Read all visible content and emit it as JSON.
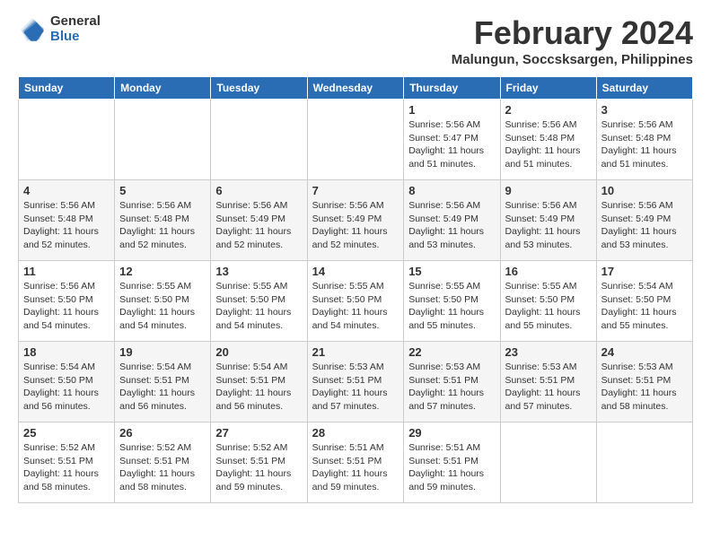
{
  "header": {
    "logo_general": "General",
    "logo_blue": "Blue",
    "month_title": "February 2024",
    "location": "Malungun, Soccsksargen, Philippines"
  },
  "days_of_week": [
    "Sunday",
    "Monday",
    "Tuesday",
    "Wednesday",
    "Thursday",
    "Friday",
    "Saturday"
  ],
  "weeks": [
    [
      {
        "num": "",
        "info": ""
      },
      {
        "num": "",
        "info": ""
      },
      {
        "num": "",
        "info": ""
      },
      {
        "num": "",
        "info": ""
      },
      {
        "num": "1",
        "info": "Sunrise: 5:56 AM\nSunset: 5:47 PM\nDaylight: 11 hours\nand 51 minutes."
      },
      {
        "num": "2",
        "info": "Sunrise: 5:56 AM\nSunset: 5:48 PM\nDaylight: 11 hours\nand 51 minutes."
      },
      {
        "num": "3",
        "info": "Sunrise: 5:56 AM\nSunset: 5:48 PM\nDaylight: 11 hours\nand 51 minutes."
      }
    ],
    [
      {
        "num": "4",
        "info": "Sunrise: 5:56 AM\nSunset: 5:48 PM\nDaylight: 11 hours\nand 52 minutes."
      },
      {
        "num": "5",
        "info": "Sunrise: 5:56 AM\nSunset: 5:48 PM\nDaylight: 11 hours\nand 52 minutes."
      },
      {
        "num": "6",
        "info": "Sunrise: 5:56 AM\nSunset: 5:49 PM\nDaylight: 11 hours\nand 52 minutes."
      },
      {
        "num": "7",
        "info": "Sunrise: 5:56 AM\nSunset: 5:49 PM\nDaylight: 11 hours\nand 52 minutes."
      },
      {
        "num": "8",
        "info": "Sunrise: 5:56 AM\nSunset: 5:49 PM\nDaylight: 11 hours\nand 53 minutes."
      },
      {
        "num": "9",
        "info": "Sunrise: 5:56 AM\nSunset: 5:49 PM\nDaylight: 11 hours\nand 53 minutes."
      },
      {
        "num": "10",
        "info": "Sunrise: 5:56 AM\nSunset: 5:49 PM\nDaylight: 11 hours\nand 53 minutes."
      }
    ],
    [
      {
        "num": "11",
        "info": "Sunrise: 5:56 AM\nSunset: 5:50 PM\nDaylight: 11 hours\nand 54 minutes."
      },
      {
        "num": "12",
        "info": "Sunrise: 5:55 AM\nSunset: 5:50 PM\nDaylight: 11 hours\nand 54 minutes."
      },
      {
        "num": "13",
        "info": "Sunrise: 5:55 AM\nSunset: 5:50 PM\nDaylight: 11 hours\nand 54 minutes."
      },
      {
        "num": "14",
        "info": "Sunrise: 5:55 AM\nSunset: 5:50 PM\nDaylight: 11 hours\nand 54 minutes."
      },
      {
        "num": "15",
        "info": "Sunrise: 5:55 AM\nSunset: 5:50 PM\nDaylight: 11 hours\nand 55 minutes."
      },
      {
        "num": "16",
        "info": "Sunrise: 5:55 AM\nSunset: 5:50 PM\nDaylight: 11 hours\nand 55 minutes."
      },
      {
        "num": "17",
        "info": "Sunrise: 5:54 AM\nSunset: 5:50 PM\nDaylight: 11 hours\nand 55 minutes."
      }
    ],
    [
      {
        "num": "18",
        "info": "Sunrise: 5:54 AM\nSunset: 5:50 PM\nDaylight: 11 hours\nand 56 minutes."
      },
      {
        "num": "19",
        "info": "Sunrise: 5:54 AM\nSunset: 5:51 PM\nDaylight: 11 hours\nand 56 minutes."
      },
      {
        "num": "20",
        "info": "Sunrise: 5:54 AM\nSunset: 5:51 PM\nDaylight: 11 hours\nand 56 minutes."
      },
      {
        "num": "21",
        "info": "Sunrise: 5:53 AM\nSunset: 5:51 PM\nDaylight: 11 hours\nand 57 minutes."
      },
      {
        "num": "22",
        "info": "Sunrise: 5:53 AM\nSunset: 5:51 PM\nDaylight: 11 hours\nand 57 minutes."
      },
      {
        "num": "23",
        "info": "Sunrise: 5:53 AM\nSunset: 5:51 PM\nDaylight: 11 hours\nand 57 minutes."
      },
      {
        "num": "24",
        "info": "Sunrise: 5:53 AM\nSunset: 5:51 PM\nDaylight: 11 hours\nand 58 minutes."
      }
    ],
    [
      {
        "num": "25",
        "info": "Sunrise: 5:52 AM\nSunset: 5:51 PM\nDaylight: 11 hours\nand 58 minutes."
      },
      {
        "num": "26",
        "info": "Sunrise: 5:52 AM\nSunset: 5:51 PM\nDaylight: 11 hours\nand 58 minutes."
      },
      {
        "num": "27",
        "info": "Sunrise: 5:52 AM\nSunset: 5:51 PM\nDaylight: 11 hours\nand 59 minutes."
      },
      {
        "num": "28",
        "info": "Sunrise: 5:51 AM\nSunset: 5:51 PM\nDaylight: 11 hours\nand 59 minutes."
      },
      {
        "num": "29",
        "info": "Sunrise: 5:51 AM\nSunset: 5:51 PM\nDaylight: 11 hours\nand 59 minutes."
      },
      {
        "num": "",
        "info": ""
      },
      {
        "num": "",
        "info": ""
      }
    ]
  ]
}
